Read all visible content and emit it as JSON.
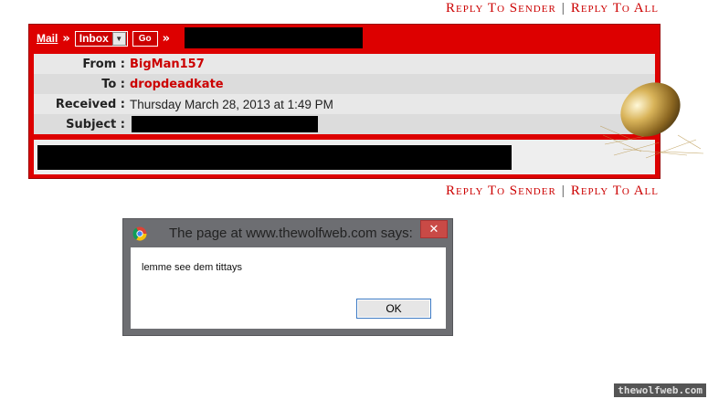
{
  "reply_links": {
    "reply_to_sender": "Reply To Sender",
    "separator": "|",
    "reply_to_all": "Reply To All"
  },
  "nav": {
    "mail_label": "Mail",
    "raquo": "»",
    "folder_selected": "Inbox",
    "go_label": "Go"
  },
  "headers": {
    "from_label": "From :",
    "from_value": "BigMan157",
    "to_label": "To :",
    "to_value": "dropdeadkate",
    "received_label": "Received :",
    "received_value": "Thursday March 28, 2013 at 1:49 PM",
    "subject_label": "Subject :"
  },
  "dialog": {
    "title": "The page at www.thewolfweb.com says:",
    "close_glyph": "✕",
    "message": "lemme see dem tittays",
    "ok_label": "OK"
  },
  "watermark": "thewolfweb.com",
  "colors": {
    "accent_red": "#dd0000",
    "link_red": "#cc0000"
  }
}
